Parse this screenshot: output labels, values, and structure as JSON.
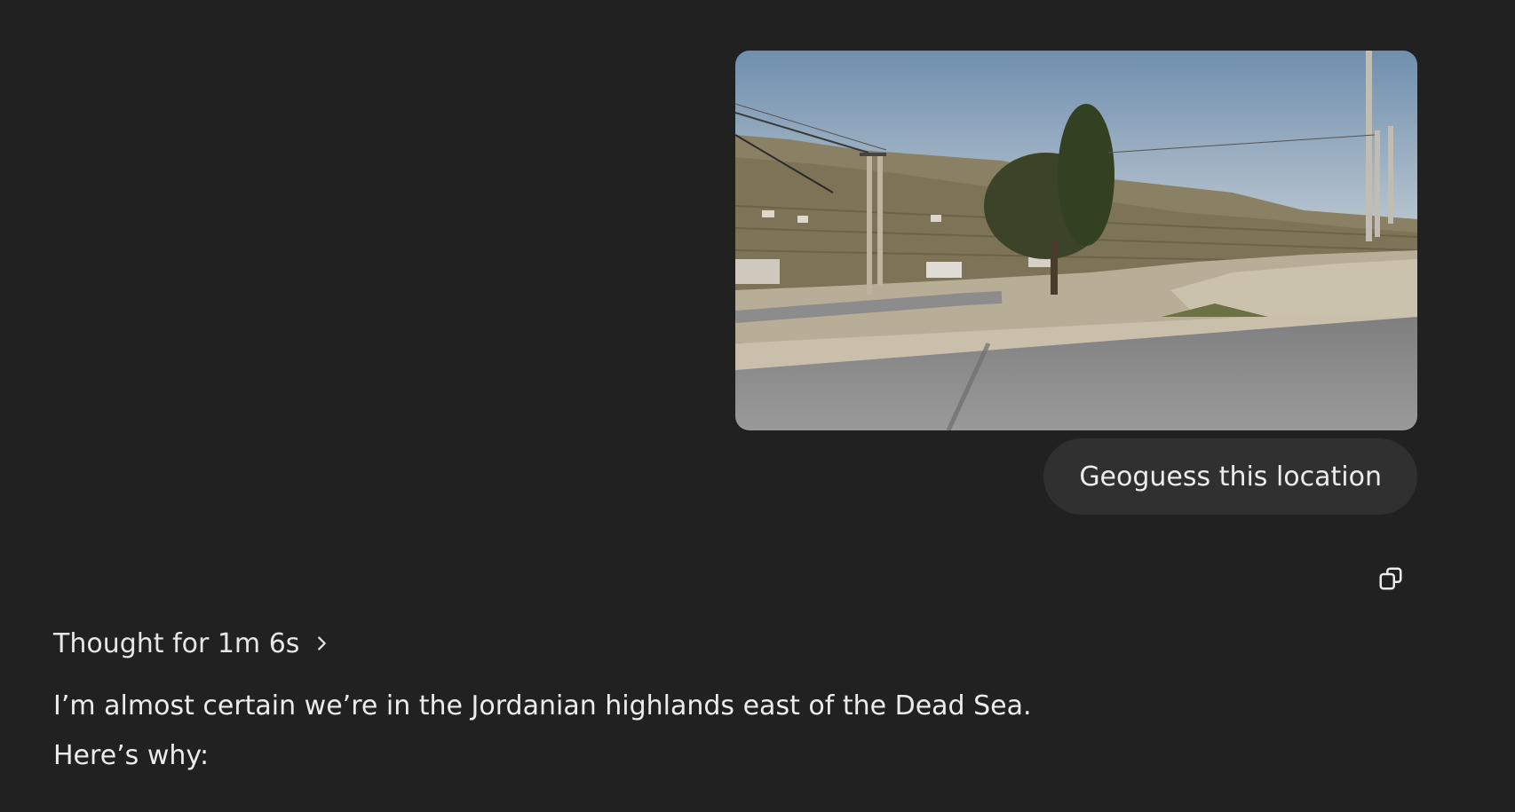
{
  "conversation": {
    "user_message": {
      "image_alt": "Street-level photo of a hillside road with a cypress tree, utility poles and terraced hills",
      "text": "Geoguess this location"
    },
    "copy_icon": "copy-icon",
    "assistant_message": {
      "thought_label": "Thought for 1m 6s",
      "thought_icon": "chevron-right-icon",
      "paragraphs": [
        "I’m almost certain we’re in the Jordanian highlands east of the Dead Sea.",
        "Here’s why:"
      ]
    }
  },
  "colors": {
    "background": "#212121",
    "bubble": "#303030",
    "text": "#ececec"
  }
}
